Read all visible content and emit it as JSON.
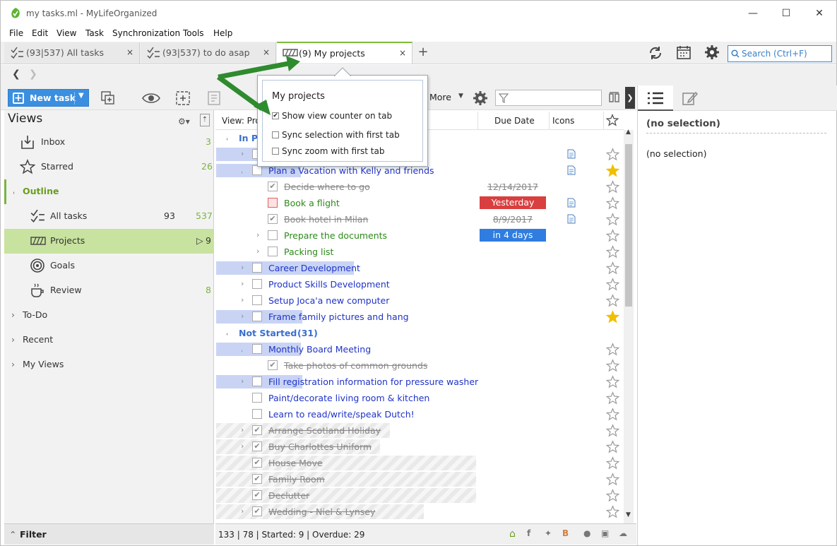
{
  "window": {
    "title": "my tasks.ml - MyLifeOrganized",
    "minimize": "—",
    "maximize": "☐",
    "close": "✕"
  },
  "menu": [
    "File",
    "Edit",
    "View",
    "Task",
    "Synchronization",
    "Tools",
    "Help"
  ],
  "tabs": [
    {
      "label": "(93|537) All tasks",
      "close": "×"
    },
    {
      "label": "(93|537) to do asap",
      "close": "×"
    },
    {
      "label": "(9) My projects",
      "close": "×"
    }
  ],
  "add_tab": "+",
  "search": {
    "placeholder": "Search (Ctrl+F)"
  },
  "toolbar": {
    "new_task": "New task",
    "more": "More"
  },
  "sidebar": {
    "title": "Views",
    "items": [
      {
        "label": "Inbox",
        "count": "3"
      },
      {
        "label": "Starred",
        "count": "26"
      },
      {
        "label": "Outline",
        "count": ""
      },
      {
        "label": "All tasks",
        "count1": "93",
        "count2": "537"
      },
      {
        "label": "Projects",
        "count": "9",
        "marker": "▷"
      },
      {
        "label": "Goals",
        "count": ""
      },
      {
        "label": "Review",
        "count": "8"
      },
      {
        "label": "To-Do",
        "count": ""
      },
      {
        "label": "Recent",
        "count": ""
      },
      {
        "label": "My Views",
        "count": ""
      }
    ],
    "filter": "Filter"
  },
  "grid": {
    "headers": {
      "view": "View: Proje",
      "due": "Due Date",
      "icons": "Icons"
    },
    "groups": [
      {
        "label": "In Pro",
        "count": ""
      },
      {
        "label": "Not Started",
        "count": "(31)"
      }
    ],
    "rows": [
      {
        "text": "",
        "due": ""
      },
      {
        "text": "Plan a Vacation with Kelly and friends",
        "due": ""
      },
      {
        "text": "Decide where to go",
        "due": "12/14/2017"
      },
      {
        "text": "Book a flight",
        "due": "Yesterday"
      },
      {
        "text": "Book hotel in Milan",
        "due": "8/9/2017"
      },
      {
        "text": "Prepare the documents",
        "due": "in 4 days"
      },
      {
        "text": "Packing list",
        "due": ""
      },
      {
        "text": "Career Development",
        "due": ""
      },
      {
        "text": "Product Skills Development",
        "due": ""
      },
      {
        "text": "Setup Joca'a new computer",
        "due": ""
      },
      {
        "text": "Frame family pictures and hang",
        "due": ""
      },
      {
        "text": "Monthly Board Meeting",
        "due": ""
      },
      {
        "text": "Take photos of common grounds",
        "due": ""
      },
      {
        "text": "Fill registration information for pressure washer",
        "due": ""
      },
      {
        "text": "Paint/decorate living room & kitchen",
        "due": ""
      },
      {
        "text": "Learn to read/write/speak Dutch!",
        "due": ""
      },
      {
        "text": "Arrange Scotland Holiday",
        "due": ""
      },
      {
        "text": "Buy Charlottes Uniform",
        "due": ""
      },
      {
        "text": "House Move",
        "due": ""
      },
      {
        "text": "Family Room",
        "due": ""
      },
      {
        "text": "Declutter",
        "due": ""
      },
      {
        "text": "Wedding - Niel & Lynsey",
        "due": ""
      }
    ]
  },
  "statusbar": "133 | 78 | Started: 9 | Overdue: 29",
  "right_panel": {
    "title": "(no selection)",
    "body": "(no selection)"
  },
  "popup": {
    "title": "My projects",
    "options": [
      {
        "label": "Show view counter on tab",
        "checked": "✔"
      },
      {
        "label": "Sync selection with first tab",
        "checked": ""
      },
      {
        "label": "Sync zoom with first tab",
        "checked": ""
      }
    ]
  },
  "colors": {
    "accent": "#3b8fe0",
    "selection": "#c8e29f",
    "overdue": "#d93f3f",
    "upcoming": "#2f7de0",
    "star": "#f0c000"
  }
}
